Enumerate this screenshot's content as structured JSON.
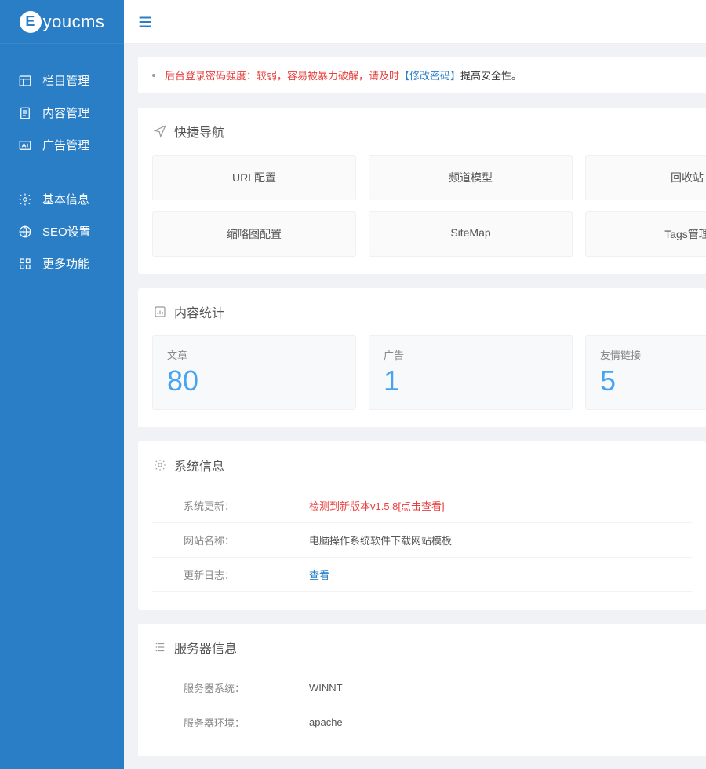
{
  "brand": {
    "prefix": "E",
    "suffix": "youcms"
  },
  "sidebar": {
    "group1": [
      {
        "label": "栏目管理",
        "icon": "columns"
      },
      {
        "label": "内容管理",
        "icon": "file"
      },
      {
        "label": "广告管理",
        "icon": "ad"
      }
    ],
    "group2": [
      {
        "label": "基本信息",
        "icon": "gear"
      },
      {
        "label": "SEO设置",
        "icon": "globe"
      },
      {
        "label": "更多功能",
        "icon": "grid"
      }
    ]
  },
  "alert": {
    "prefix": "后台登录密码强度：较弱，容易被暴力破解，请及时 ",
    "link": "【修改密码】",
    "suffix": "提高安全性。"
  },
  "quicknav": {
    "title": "快捷导航",
    "row1": [
      "URL配置",
      "频道模型",
      "回收站"
    ],
    "row2": [
      "缩略图配置",
      "SiteMap",
      "Tags管理"
    ]
  },
  "stats": {
    "title": "内容统计",
    "items": [
      {
        "label": "文章",
        "value": "80"
      },
      {
        "label": "广告",
        "value": "1"
      },
      {
        "label": "友情链接",
        "value": "5"
      }
    ]
  },
  "sysinfo": {
    "title": "系统信息",
    "rows": [
      {
        "label": "系统更新：",
        "value": "检测到新版本v1.5.8[点击查看]",
        "style": "red"
      },
      {
        "label": "网站名称：",
        "value": "电脑操作系统软件下载网站模板",
        "style": ""
      },
      {
        "label": "更新日志：",
        "value": "查看",
        "style": "link"
      }
    ]
  },
  "serverinfo": {
    "title": "服务器信息",
    "rows": [
      {
        "label": "服务器系统：",
        "value": "WINNT"
      },
      {
        "label": "服务器环境：",
        "value": "apache"
      }
    ]
  }
}
